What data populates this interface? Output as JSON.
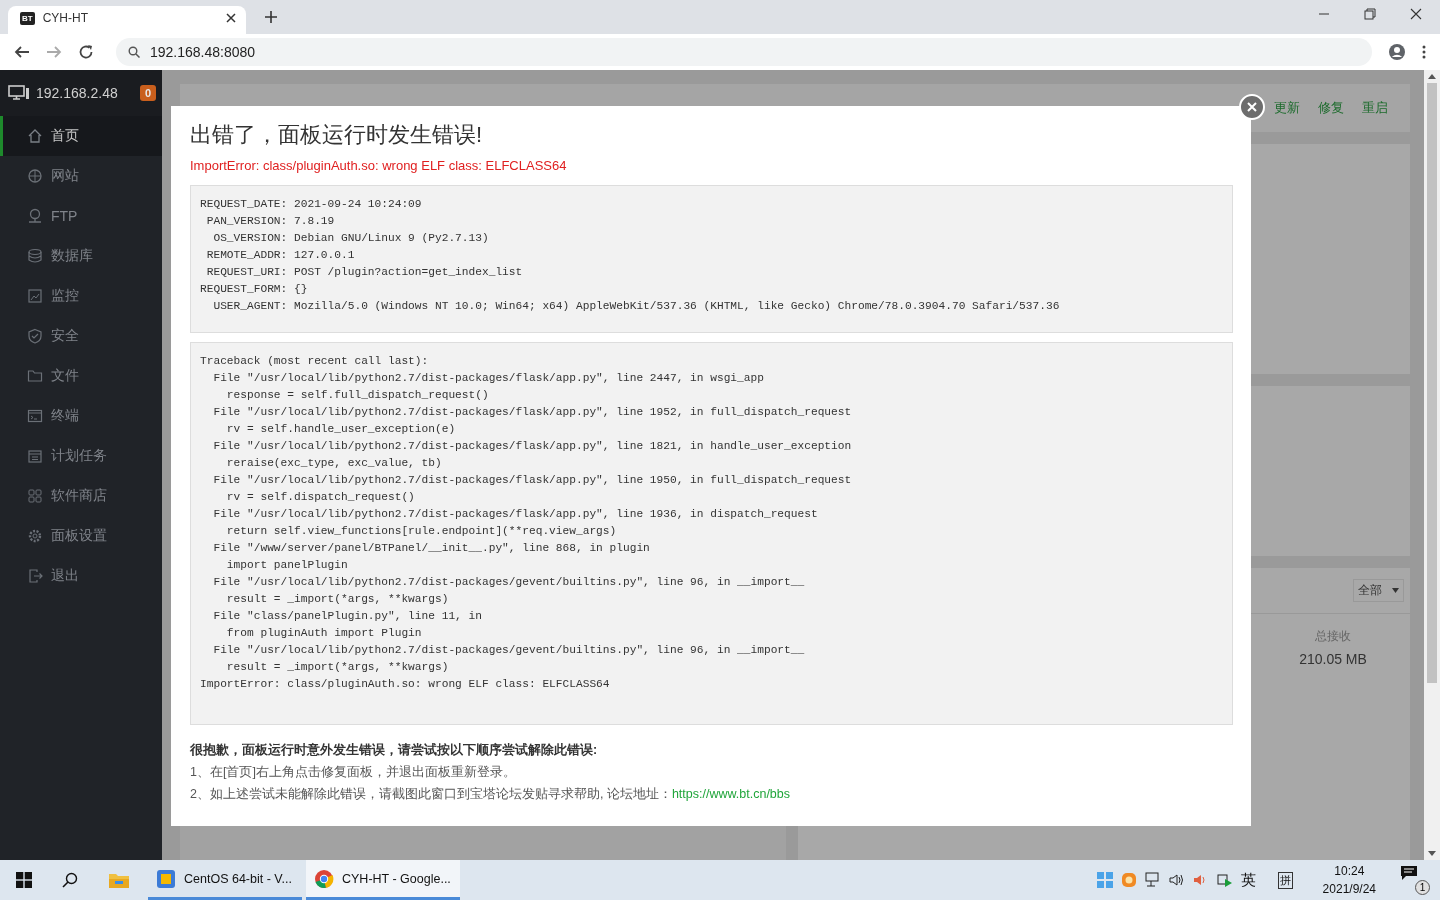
{
  "browser": {
    "tab_title": "CYH-HT",
    "favicon": "BT",
    "address": "192.168.48:8080"
  },
  "sidebar": {
    "host": "192.168.2.48",
    "badge": "0",
    "items": [
      {
        "label": "首页",
        "kind": "home",
        "selected": true
      },
      {
        "label": "网站",
        "kind": "globe",
        "selected": false
      },
      {
        "label": "FTP",
        "kind": "ftp",
        "selected": false
      },
      {
        "label": "数据库",
        "kind": "db",
        "selected": false
      },
      {
        "label": "监控",
        "kind": "chart",
        "selected": false
      },
      {
        "label": "安全",
        "kind": "shield",
        "selected": false
      },
      {
        "label": "文件",
        "kind": "folder",
        "selected": false
      },
      {
        "label": "终端",
        "kind": "terminal",
        "selected": false
      },
      {
        "label": "计划任务",
        "kind": "calendar",
        "selected": false
      },
      {
        "label": "软件商店",
        "kind": "grid",
        "selected": false
      },
      {
        "label": "面板设置",
        "kind": "gear",
        "selected": false
      },
      {
        "label": "退出",
        "kind": "exit",
        "selected": false
      }
    ]
  },
  "header_links": [
    "更新",
    "修复",
    "重启"
  ],
  "traffic": {
    "filter": "全部",
    "label": "总接收",
    "value": "210.05 MB"
  },
  "dialog": {
    "title": "出错了，面板运行时发生错误!",
    "error": "ImportError: class/pluginAuth.so: wrong ELF class: ELFCLASS64",
    "request_info": [
      "REQUEST_DATE: 2021-09-24 10:24:09",
      " PAN_VERSION: 7.8.19",
      "  OS_VERSION: Debian GNU/Linux 9 (Py2.7.13)",
      " REMOTE_ADDR: 127.0.0.1",
      " REQUEST_URI: POST /plugin?action=get_index_list",
      "REQUEST_FORM: {}",
      "  USER_AGENT: Mozilla/5.0 (Windows NT 10.0; Win64; x64) AppleWebKit/537.36 (KHTML, like Gecko) Chrome/78.0.3904.70 Safari/537.36"
    ],
    "traceback": [
      "Traceback (most recent call last):",
      "  File \"/usr/local/lib/python2.7/dist-packages/flask/app.py\", line 2447, in wsgi_app",
      "    response = self.full_dispatch_request()",
      "  File \"/usr/local/lib/python2.7/dist-packages/flask/app.py\", line 1952, in full_dispatch_request",
      "    rv = self.handle_user_exception(e)",
      "  File \"/usr/local/lib/python2.7/dist-packages/flask/app.py\", line 1821, in handle_user_exception",
      "    reraise(exc_type, exc_value, tb)",
      "  File \"/usr/local/lib/python2.7/dist-packages/flask/app.py\", line 1950, in full_dispatch_request",
      "    rv = self.dispatch_request()",
      "  File \"/usr/local/lib/python2.7/dist-packages/flask/app.py\", line 1936, in dispatch_request",
      "    return self.view_functions[rule.endpoint](**req.view_args)",
      "  File \"/www/server/panel/BTPanel/__init__.py\", line 868, in plugin",
      "    import panelPlugin",
      "  File \"/usr/local/lib/python2.7/dist-packages/gevent/builtins.py\", line 96, in __import__",
      "    result = _import(*args, **kwargs)",
      "  File \"class/panelPlugin.py\", line 11, in",
      "    from pluginAuth import Plugin",
      "  File \"/usr/local/lib/python2.7/dist-packages/gevent/builtins.py\", line 96, in __import__",
      "    result = _import(*args, **kwargs)",
      "ImportError: class/pluginAuth.so: wrong ELF class: ELFCLASS64"
    ],
    "help_title": "很抱歉，面板运行时意外发生错误，请尝试按以下顺序尝试解除此错误:",
    "help_steps": [
      "1、在[首页]右上角点击修复面板，并退出面板重新登录。",
      "2、如上述尝试未能解除此错误，请截图此窗口到宝塔论坛发贴寻求帮助, 论坛地址："
    ],
    "link": "https://www.bt.cn/bbs"
  },
  "taskbar": {
    "apps": [
      {
        "label": "CentOS 64-bit - V...",
        "kind": "vm",
        "selected": false
      },
      {
        "label": "CYH-HT - Google...",
        "kind": "chrome",
        "selected": true
      }
    ],
    "ime": [
      "英",
      "拼"
    ],
    "time": "10:24",
    "date": "2021/9/24",
    "notifications": "1"
  }
}
